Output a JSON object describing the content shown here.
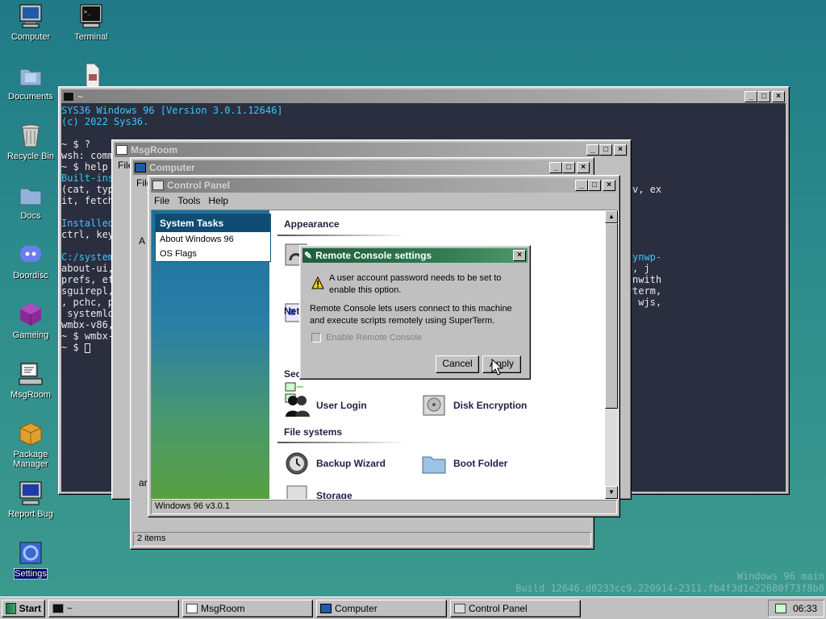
{
  "desktop": {
    "icons": [
      {
        "label": "Computer"
      },
      {
        "label": "Terminal"
      },
      {
        "label": "Documents"
      },
      {
        "label": "Recycle Bin"
      },
      {
        "label": "Docs"
      },
      {
        "label": "Doordisc"
      },
      {
        "label": "Gameing"
      },
      {
        "label": "MsgRoom"
      },
      {
        "label": "Package Manager"
      },
      {
        "label": "Report Bug"
      },
      {
        "label": "Settings"
      }
    ],
    "watermark_line1": "Windows 96 main",
    "watermark_line2": "Build 12646.d0233cc9.220914-2311.fb4f3d1e22680f73f8b8"
  },
  "terminal_window": {
    "title": "~",
    "lines": [
      "SYS36 Windows 96 [Version 3.0.1.12646]",
      "(c) 2022 Sys36.",
      "",
      "~ $ ?",
      "wsh: comm",
      "~ $ help",
      "Built-ins",
      "(cat, typ                                                                     ete), bins, echo, env, ex",
      "it, fetch",
      "",
      "Installed",
      "ctrl, key",
      "",
      "C:/system                                                                     osbox, dtool, dyk, dynwp-",
      "about-ui,                                                                     imgviewer, internete, j",
      "prefs, ef                                                                     hotron, openurl, openwith",
      "sguirepl,                                                                      super-player, superterm,",
      ", pchc, p                                                                      in96-chat, winmp96, wjs,",
      " systemlo",
      "wmbx-v86,",
      "~ $ wmbx-",
      "~ $ "
    ]
  },
  "msgroom_window": {
    "title": "MsgRoom",
    "menu": [
      "File"
    ]
  },
  "computer_window": {
    "title": "Computer",
    "menu": [
      "File"
    ],
    "status": "2 items",
    "addr_fragment": "A",
    "side_fragment": "ar"
  },
  "control_panel": {
    "title": "Control Panel",
    "menu": [
      "File",
      "Tools",
      "Help"
    ],
    "system_tasks": {
      "header": "System Tasks",
      "items": [
        "About Windows 96",
        "OS Flags"
      ]
    },
    "sections": {
      "appearance": "Appearance",
      "network": "Netw",
      "security": "Sec",
      "file_systems": "File systems"
    },
    "items": {
      "user_login": "User Login",
      "disk_encryption": "Disk Encryption",
      "backup_wizard": "Backup Wizard",
      "boot_folder": "Boot Folder",
      "storage": "Storage"
    },
    "status": "Windows 96 v3.0.1"
  },
  "dialog": {
    "title": "Remote Console settings",
    "warning": "A user account password needs to be set to enable this option.",
    "description": "Remote Console lets users connect to this machine and execute scripts remotely using SuperTerm.",
    "checkbox_label": "Enable Remote Console",
    "checkbox_checked": false,
    "cancel_label": "Cancel",
    "apply_label": "Apply"
  },
  "taskbar": {
    "start_label": "Start",
    "tasks": [
      {
        "label": "~"
      },
      {
        "label": "MsgRoom"
      },
      {
        "label": "Computer"
      },
      {
        "label": "Control Panel"
      }
    ],
    "clock": "06:33"
  },
  "colors": {
    "accent_title": "#2f7a50",
    "terminal_bg": "#2a2e3f",
    "terminal_cyan": "#3ac7f5"
  }
}
